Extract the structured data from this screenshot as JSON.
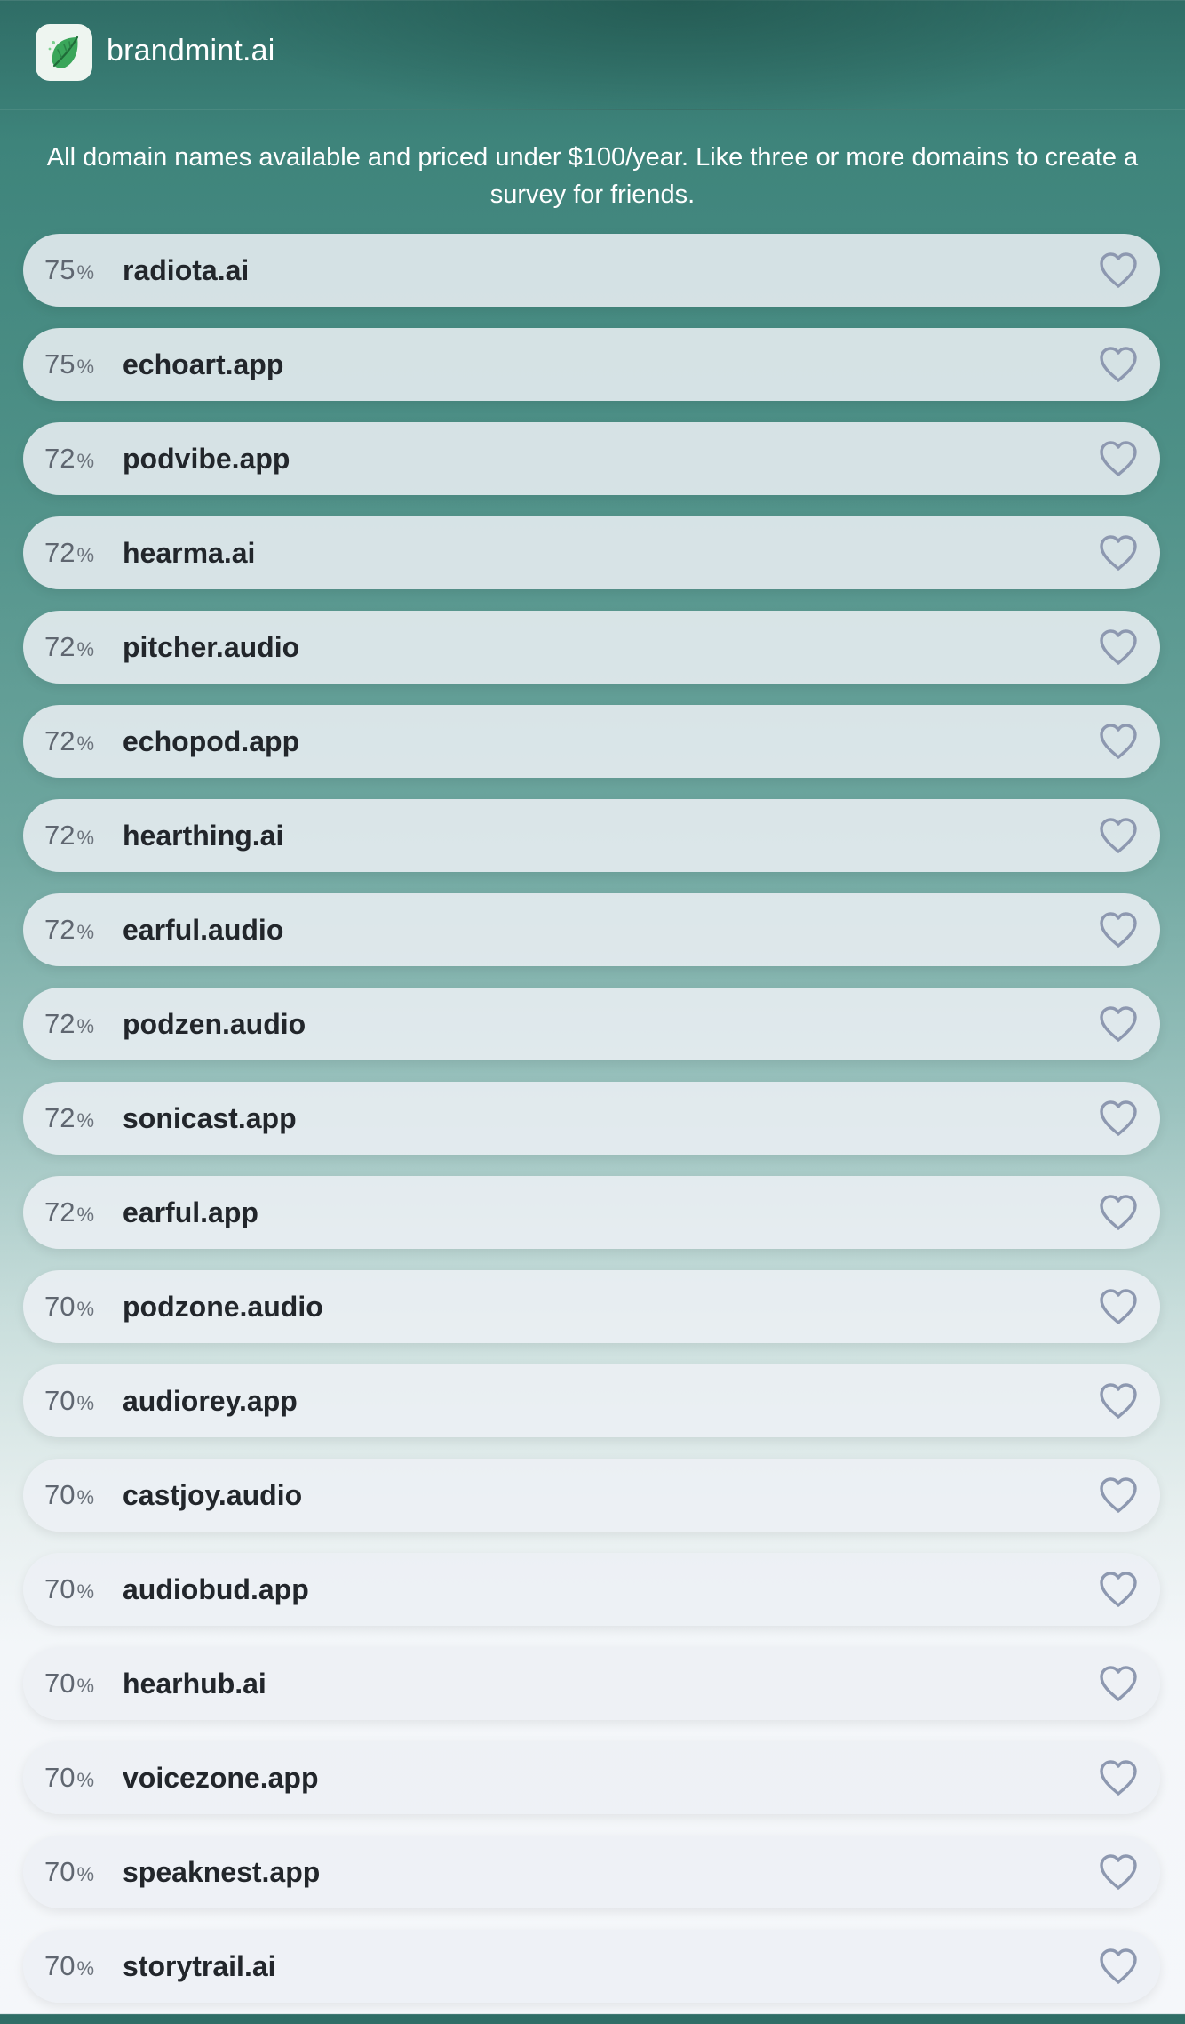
{
  "app": {
    "brand": "brandmint.ai",
    "logo_icon": "leaf-icon"
  },
  "intro": {
    "text": "All domain names available and priced under $100/year. Like three or more domains to create a survey for friends."
  },
  "colors": {
    "accent": "#2f6d66",
    "heart": "#8d98b0",
    "leaf": "#3aa65a"
  },
  "domains": [
    {
      "score": "75",
      "name": "radiota.ai"
    },
    {
      "score": "75",
      "name": "echoart.app"
    },
    {
      "score": "72",
      "name": "podvibe.app"
    },
    {
      "score": "72",
      "name": "hearma.ai"
    },
    {
      "score": "72",
      "name": "pitcher.audio"
    },
    {
      "score": "72",
      "name": "echopod.app"
    },
    {
      "score": "72",
      "name": "hearthing.ai"
    },
    {
      "score": "72",
      "name": "earful.audio"
    },
    {
      "score": "72",
      "name": "podzen.audio"
    },
    {
      "score": "72",
      "name": "sonicast.app"
    },
    {
      "score": "72",
      "name": "earful.app"
    },
    {
      "score": "70",
      "name": "podzone.audio"
    },
    {
      "score": "70",
      "name": "audiorey.app"
    },
    {
      "score": "70",
      "name": "castjoy.audio"
    },
    {
      "score": "70",
      "name": "audiobud.app"
    },
    {
      "score": "70",
      "name": "hearhub.ai"
    },
    {
      "score": "70",
      "name": "voicezone.app"
    },
    {
      "score": "70",
      "name": "speaknest.app"
    },
    {
      "score": "70",
      "name": "storytrail.ai"
    }
  ],
  "percent_sign": "%"
}
